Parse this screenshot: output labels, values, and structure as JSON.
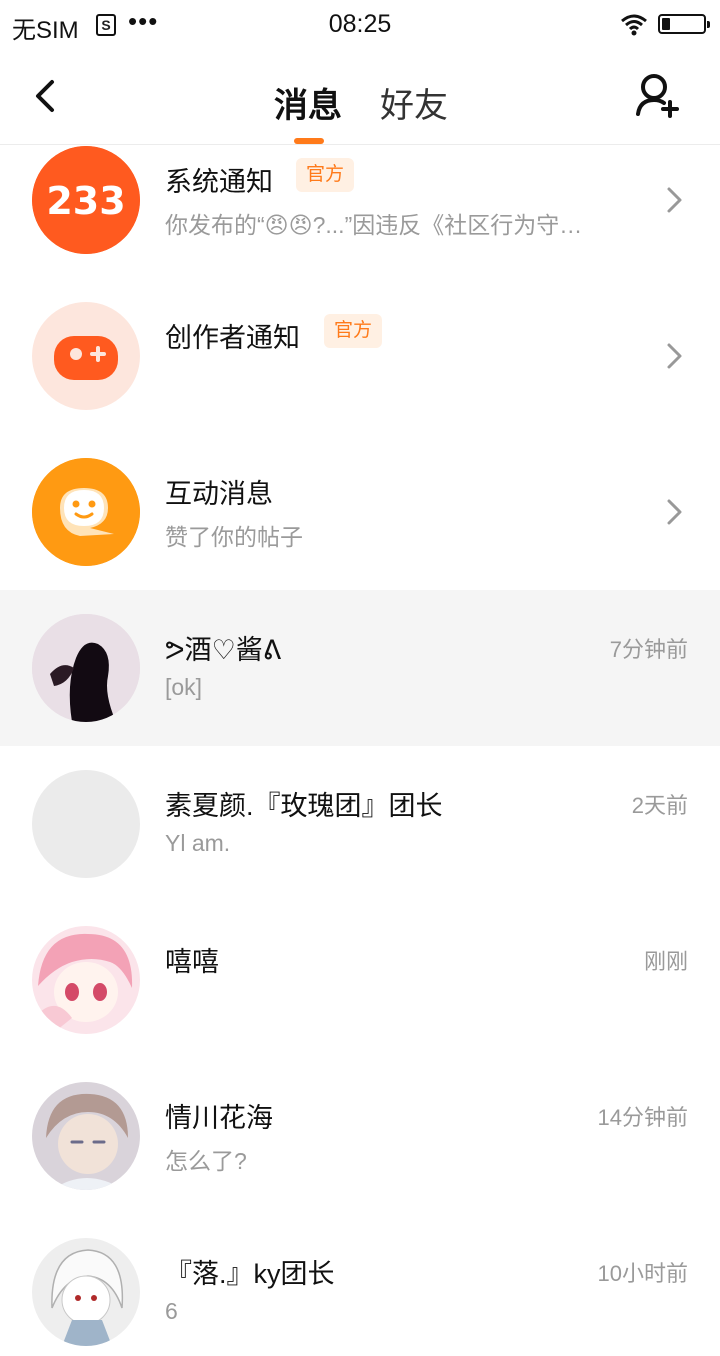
{
  "status_bar": {
    "carrier": "无SIM",
    "s_icon": "S",
    "dots": "•••",
    "time": "08:25"
  },
  "nav": {
    "tab_messages": "消息",
    "tab_friends": "好友"
  },
  "system_items": [
    {
      "title": "系统通知",
      "badge": "官方",
      "subtitle": "你发布的“😠😠?...”因违反《社区行为守…",
      "avatar_text": "233"
    },
    {
      "title": "创作者通知",
      "badge": "官方",
      "subtitle": ""
    },
    {
      "title": "互动消息",
      "badge": "",
      "subtitle": "赞了你的帖子"
    }
  ],
  "chats": [
    {
      "name": "ᕗ酒♡酱ᕕ",
      "preview": "[ok]",
      "time": "7分钟前"
    },
    {
      "name": "素夏颜.『玫瑰团』团长",
      "preview": "Yl am.",
      "time": "2天前"
    },
    {
      "name": "嘻嘻",
      "preview": "",
      "time": "刚刚"
    },
    {
      "name": "情川花海",
      "preview": "怎么了?",
      "time": "14分钟前"
    },
    {
      "name": "『落.』ky团长",
      "preview": "6",
      "time": "10小时前"
    }
  ],
  "colors": {
    "accent": "#ff7a1a"
  }
}
